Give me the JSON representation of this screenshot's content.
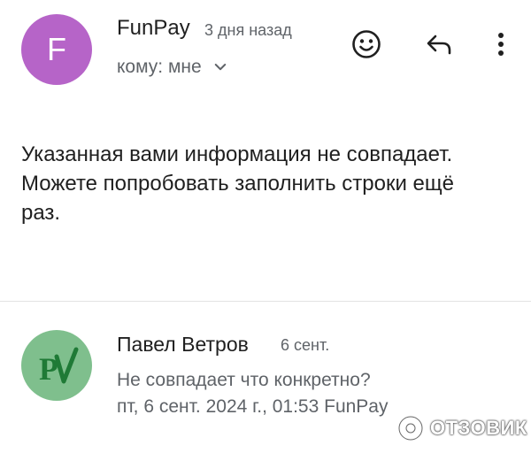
{
  "message1": {
    "avatar_letter": "F",
    "avatar_color": "#b664c8",
    "sender": "FunPay",
    "time": "3 дня назад",
    "recipient": "кому: мне",
    "icons": [
      "emoji-icon",
      "reply-icon",
      "more-vert-icon",
      "chevron-down-icon"
    ],
    "body_lines": [
      "Указанная вами информация не совпадает.",
      "Можете попробовать заполнить строки ещё",
      "раз."
    ]
  },
  "message2": {
    "avatar_color": "#7fbf8d",
    "avatar_logo_text": "PV",
    "sender": "Павел Ветров",
    "time": "6 сент.",
    "preview_line1": "Не совпадает что конкретно?",
    "preview_line2": "пт, 6 сент. 2024 г., 01:53 FunPay"
  },
  "watermark": {
    "text": "ОТЗОВИК"
  }
}
